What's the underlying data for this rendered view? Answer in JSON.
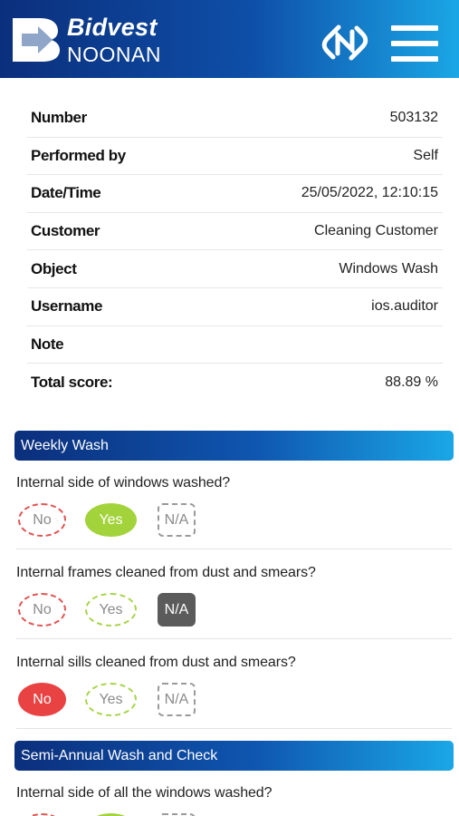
{
  "header": {
    "brand_line1": "Bidvest",
    "brand_line2": "NOONAN",
    "nfc_icon": "nfc-icon",
    "menu_icon": "hamburger-menu-icon"
  },
  "info": [
    {
      "label": "Number",
      "value": "503132"
    },
    {
      "label": "Performed by",
      "value": "Self"
    },
    {
      "label": "Date/Time",
      "value": "25/05/2022, 12:10:15"
    },
    {
      "label": "Customer",
      "value": "Cleaning Customer"
    },
    {
      "label": "Object",
      "value": "Windows Wash"
    },
    {
      "label": "Username",
      "value": "ios.auditor"
    },
    {
      "label": "Note",
      "value": ""
    },
    {
      "label": "Total score:",
      "value": "88.89 %"
    }
  ],
  "sections": [
    {
      "title": "Weekly Wash",
      "questions": [
        {
          "text": "Internal side of windows washed?",
          "selected": "Yes"
        },
        {
          "text": "Internal frames cleaned from dust and smears?",
          "selected": "N/A"
        },
        {
          "text": "Internal sills cleaned from dust and smears?",
          "selected": "No"
        }
      ]
    },
    {
      "title": "Semi-Annual Wash and Check",
      "questions": [
        {
          "text": "Internal side of all the windows washed?",
          "selected": "Yes"
        }
      ]
    }
  ],
  "options": {
    "no": "No",
    "yes": "Yes",
    "na": "N/A"
  },
  "colors": {
    "header_start": "#0b2f7c",
    "header_end": "#1aa7e6",
    "yes_selected": "#a3d33a",
    "no_selected": "#e84242",
    "na_selected": "#5b5b5b"
  }
}
